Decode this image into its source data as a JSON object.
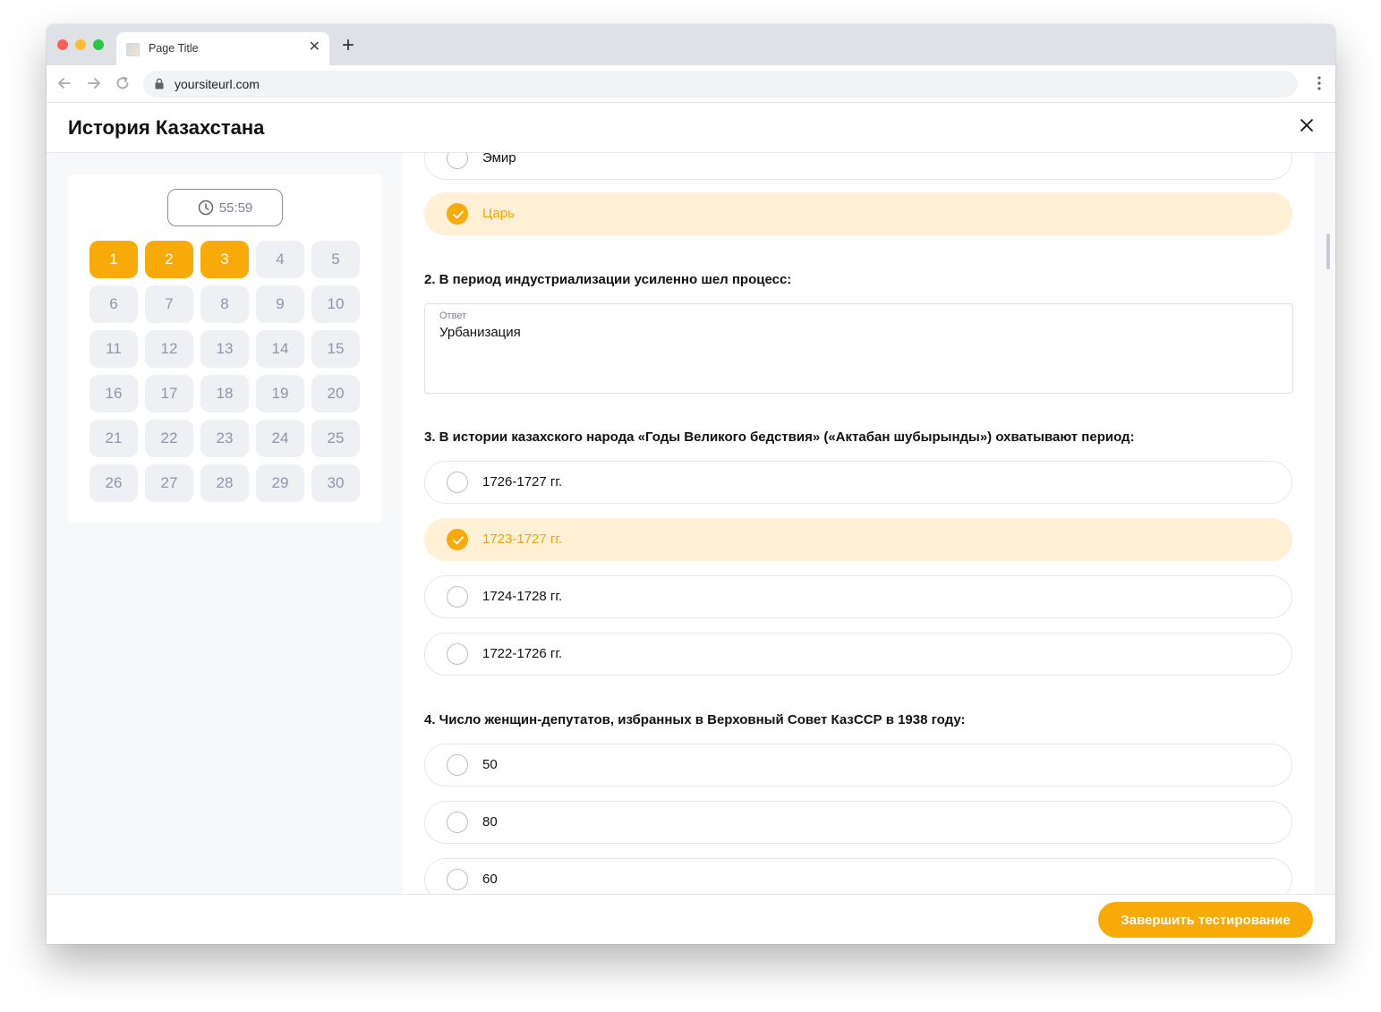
{
  "browser": {
    "tab_title": "Page Title",
    "url": "yoursiteurl.com"
  },
  "app": {
    "title": "История Казахстана"
  },
  "sidebar": {
    "timer": "55:59",
    "questions": [
      {
        "n": "1",
        "answered": true
      },
      {
        "n": "2",
        "answered": true
      },
      {
        "n": "3",
        "answered": true
      },
      {
        "n": "4",
        "answered": false
      },
      {
        "n": "5",
        "answered": false
      },
      {
        "n": "6",
        "answered": false
      },
      {
        "n": "7",
        "answered": false
      },
      {
        "n": "8",
        "answered": false
      },
      {
        "n": "9",
        "answered": false
      },
      {
        "n": "10",
        "answered": false
      },
      {
        "n": "11",
        "answered": false
      },
      {
        "n": "12",
        "answered": false
      },
      {
        "n": "13",
        "answered": false
      },
      {
        "n": "14",
        "answered": false
      },
      {
        "n": "15",
        "answered": false
      },
      {
        "n": "16",
        "answered": false
      },
      {
        "n": "17",
        "answered": false
      },
      {
        "n": "18",
        "answered": false
      },
      {
        "n": "19",
        "answered": false
      },
      {
        "n": "20",
        "answered": false
      },
      {
        "n": "21",
        "answered": false
      },
      {
        "n": "22",
        "answered": false
      },
      {
        "n": "23",
        "answered": false
      },
      {
        "n": "24",
        "answered": false
      },
      {
        "n": "25",
        "answered": false
      },
      {
        "n": "26",
        "answered": false
      },
      {
        "n": "27",
        "answered": false
      },
      {
        "n": "28",
        "answered": false
      },
      {
        "n": "29",
        "answered": false
      },
      {
        "n": "30",
        "answered": false
      }
    ]
  },
  "q1": {
    "options": [
      {
        "label": "Эмир",
        "selected": false
      },
      {
        "label": "Царь",
        "selected": true
      }
    ]
  },
  "q2": {
    "text": "2. В период индустриализации усиленно шел процесс:",
    "answer_caption": "Ответ",
    "answer_value": "Урбанизация"
  },
  "q3": {
    "text": "3. В истории казахского народа «Годы Великого бедствия» («Актабан шубырынды») охватывают период:",
    "options": [
      {
        "label": "1726-1727 гг.",
        "selected": false
      },
      {
        "label": "1723-1727 гг.",
        "selected": true
      },
      {
        "label": "1724-1728 гг.",
        "selected": false
      },
      {
        "label": "1722-1726 гг.",
        "selected": false
      }
    ]
  },
  "q4": {
    "text": "4. Число женщин-депутатов, избранных в Верховный Совет КазССР в 1938 году:",
    "options": [
      {
        "label": "50",
        "selected": false
      },
      {
        "label": "80",
        "selected": false
      },
      {
        "label": "60",
        "selected": false
      }
    ]
  },
  "footer": {
    "finish_label": "Завершить тестирование"
  },
  "colors": {
    "accent": "#f8aa08",
    "selected_bg": "#fff0d6",
    "page_bg": "#f7f8fa"
  }
}
